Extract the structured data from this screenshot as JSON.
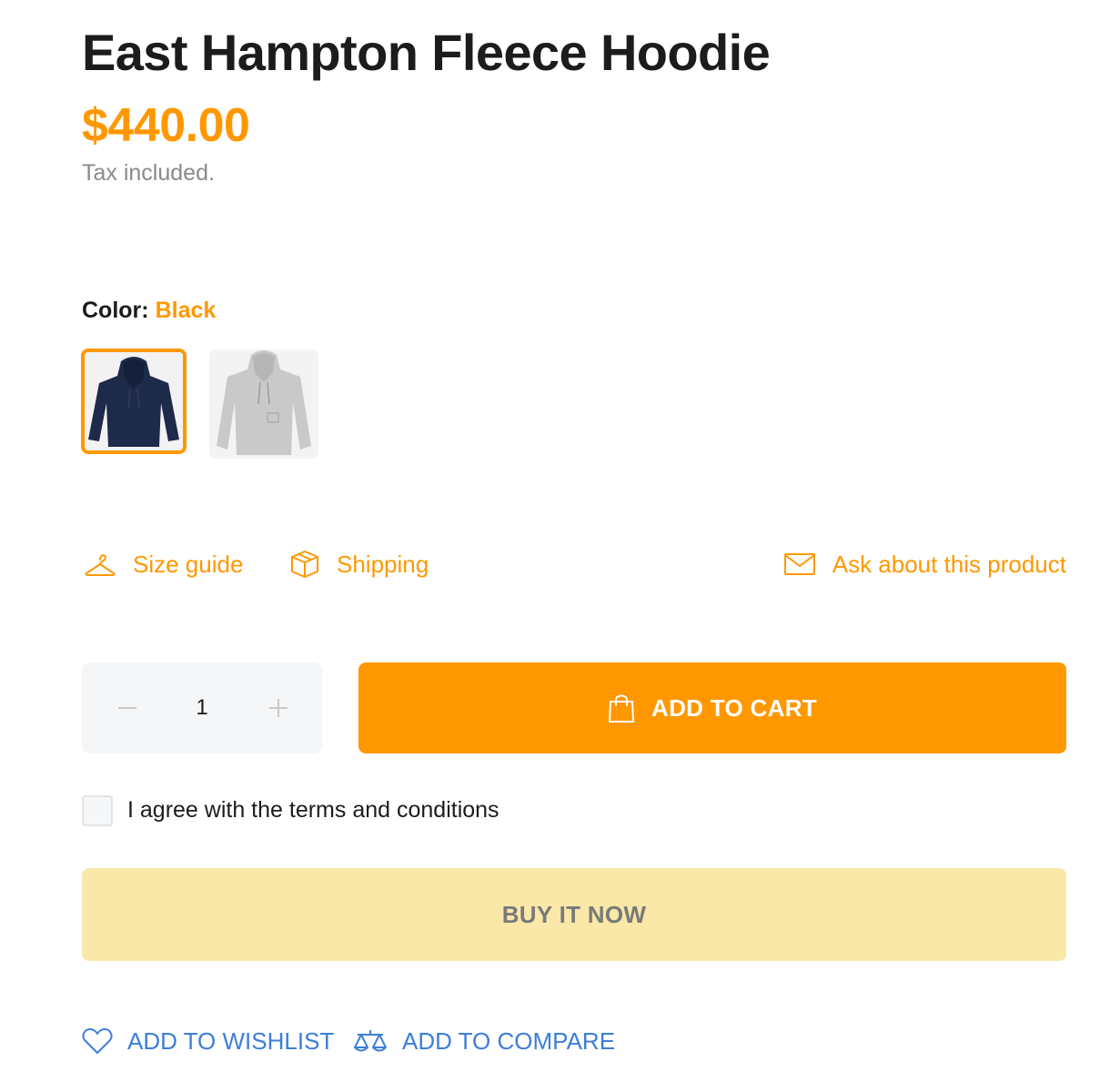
{
  "product": {
    "title": "East Hampton Fleece Hoodie",
    "price": "$440.00",
    "tax_note": "Tax included."
  },
  "color": {
    "label": "Color:",
    "selected_value": "Black",
    "swatches": [
      "navy-hoodie-swatch",
      "gray-hoodie-swatch"
    ]
  },
  "links": {
    "size_guide": "Size guide",
    "shipping": "Shipping",
    "ask": "Ask about this product"
  },
  "quantity": {
    "value": "1"
  },
  "buttons": {
    "add_to_cart": "ADD TO CART",
    "buy_now": "BUY IT NOW"
  },
  "terms": {
    "label": "I agree with the terms and conditions",
    "checked": false
  },
  "actions": {
    "wishlist": "ADD TO WISHLIST",
    "compare": "ADD TO COMPARE"
  },
  "colors": {
    "accent": "#ff9800",
    "link_blue": "#3d7ed8",
    "buy_now_bg": "#f9e8a7"
  }
}
